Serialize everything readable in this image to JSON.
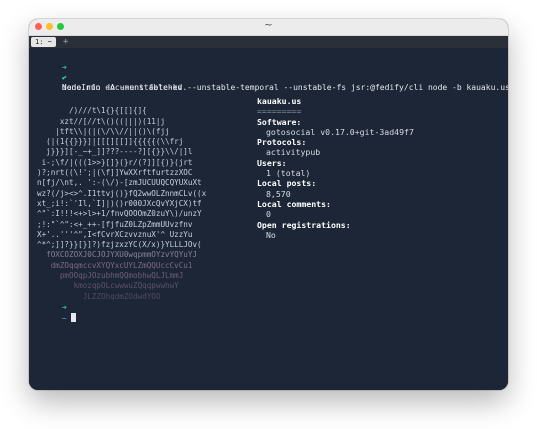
{
  "window": {
    "title": "~",
    "tab_label": "1: ~",
    "newtab_label": "+"
  },
  "terminal": {
    "prompt_arrow": "➜",
    "prompt_dir": "~",
    "command": "deno run -A --unstable-kv --unstable-temporal --unstable-fs jsr:@fedify/cli node -b kauaku.us",
    "status_check": "✔",
    "status_text": "NodeInfo document fetched."
  },
  "ascii_art": [
    "       /)///t\\1{}{[[]{]{",
    "     xzt//[//t\\()((|||)(11|j",
    "    |tft\\\\|(|(\\/\\\\//||()\\(fjj",
    "  (|(1{{}}}]|[[[][[]]{{{{{(\\\\frj",
    "  j}}}][-_~+_]]???----?][{}}\\\\/|]l",
    " i-;\\f/|(((1>>}[]}(}r/(?]][{)}(jrt",
    ")?;nrt((\\!';|(\\f]]YwXXrftfurtzzXOC",
    "n[fj/\\nt,. ':-(\\/)-[zmJUCUUQCQYUXuXt",
    "wz?(/j><>^.I1ttvj()}fQ2wwOLZnnmCLv((x",
    "xt_;i!:`'Il,`I]|)()r000JXcQvYXjCX)tf",
    "^\"`:I!!!<+>l>+1/fnvQOOOmZ0zuY\\)/unzY",
    ";!:\"`^\":<+_++-[fjfuZ0LZpZmmUUvzfnv",
    "X+'..'''^\",I<fCvrXCzvvznuX'^ UzzYu",
    "^*^;]]?}}[}]?)fzjzxzYC(X/x)}YLLLJOv(",
    "  fOXCOZOXJ0CJOJYXU0wqpmmOYzvYQYuYJ",
    "   dmZOqqmccvXYQYxcUYLZmQQUccCvCu1",
    "     pmOOqpJOzubhmQQmobhwQLJLmmJ",
    "        kmozqpOLcwwwuZQqqpwwhwY",
    "          JLZZOhqdmZOdwdYOO"
  ],
  "nodeinfo": {
    "host": "kauaku.us",
    "underline": "=========",
    "software_label": "Software:",
    "software_value": "gotosocial v0.17.0+git-3ad49f7",
    "protocols_label": "Protocols:",
    "protocols_value": "activitypub",
    "users_label": "Users:",
    "users_value": "1 (total)",
    "local_posts_label": "Local posts:",
    "local_posts_value": "8,570",
    "local_comments_label": "Local comments:",
    "local_comments_value": "0",
    "open_registrations_label": "Open registrations:",
    "open_registrations_value": "No"
  },
  "colors": {
    "terminal_bg": "#1c2636",
    "prompt_arrow": "#35c9a6",
    "prompt_dir": "#4fb0f0",
    "check": "#2fcf8c"
  }
}
